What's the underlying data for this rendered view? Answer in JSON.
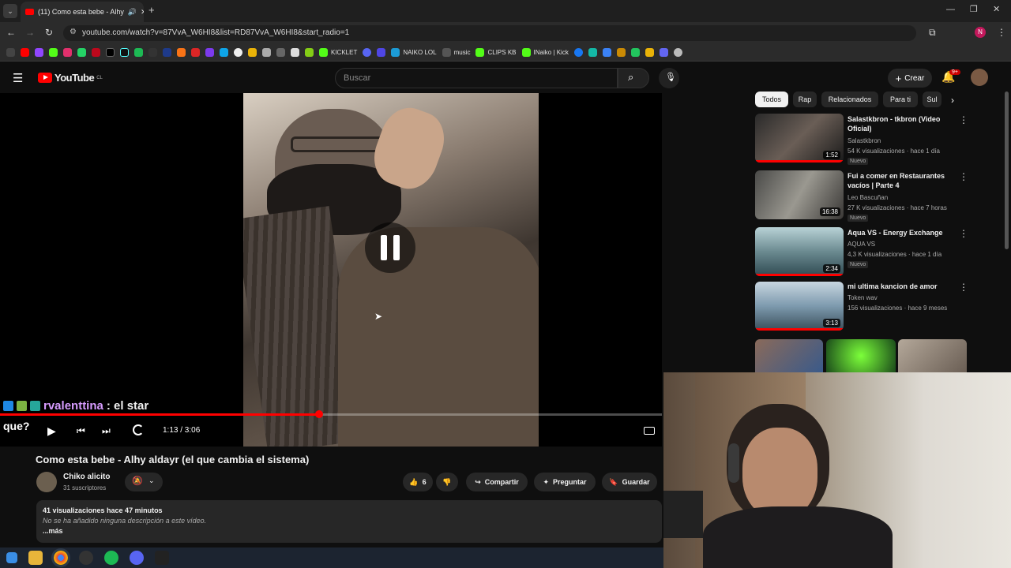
{
  "browser": {
    "tab_title": "(11) Como esta bebe - Alhy",
    "url": "youtube.com/watch?v=87VvA_W6HI8&list=RD87VvA_W6HI8&start_radio=1",
    "bookmarks": [
      {
        "label": "KICKLET",
        "color": "#53fc18"
      },
      {
        "label": "NAIKO LOL",
        "color": "#1c9bd6"
      },
      {
        "label": "music",
        "color": "#cccccc"
      },
      {
        "label": "CLIPS KB",
        "color": "#53fc18"
      },
      {
        "label": "INaiko | Kick",
        "color": "#53fc18"
      }
    ]
  },
  "youtube": {
    "logo": "YouTube",
    "country": "CL",
    "search_placeholder": "Buscar",
    "create_label": "Crear",
    "notif_count": "9+"
  },
  "player": {
    "time": "1:13 / 3:06",
    "progress_fraction": 0.39
  },
  "chat": {
    "user": "rvalenttina",
    "message": ": el star",
    "continuation": "que?"
  },
  "video": {
    "title": "Como esta bebe - Alhy aldayr (el que cambia el sistema)",
    "channel": "Chiko alicito",
    "subscribers": "31 suscriptores",
    "likes": "6",
    "share_label": "Compartir",
    "ask_label": "Preguntar",
    "save_label": "Guardar",
    "views_date": "41 visualizaciones  hace 47 minutos",
    "description": "No se ha añadido ninguna descripción a este vídeo.",
    "more_label": "...más"
  },
  "chips": [
    "Todos",
    "Rap",
    "Relacionados",
    "Para ti",
    "Sul"
  ],
  "recommendations": [
    {
      "title": "Salastkbron - tkbron (Video Oficial)",
      "channel": "Salastkbron",
      "meta": "54 K visualizaciones · hace 1 día",
      "badge": "Nuevo",
      "duration": "1:52",
      "watched": 1.0
    },
    {
      "title": "Fui a comer en Restaurantes vacíos | Parte 4",
      "channel": "Leo Bascuñan",
      "meta": "27 K visualizaciones · hace 7 horas",
      "badge": "Nuevo",
      "duration": "16:38",
      "watched": 0.0
    },
    {
      "title": "Aqua VS - Energy Exchange",
      "channel": "AQUA VS",
      "meta": "4,3 K visualizaciones · hace 1 día",
      "badge": "Nuevo",
      "duration": "2:34",
      "watched": 1.0
    },
    {
      "title": "mi ultima kancion de amor",
      "channel": "Token wav",
      "meta": "156 visualizaciones · hace 9 meses",
      "badge": "",
      "duration": "3:13",
      "watched": 1.0
    }
  ]
}
